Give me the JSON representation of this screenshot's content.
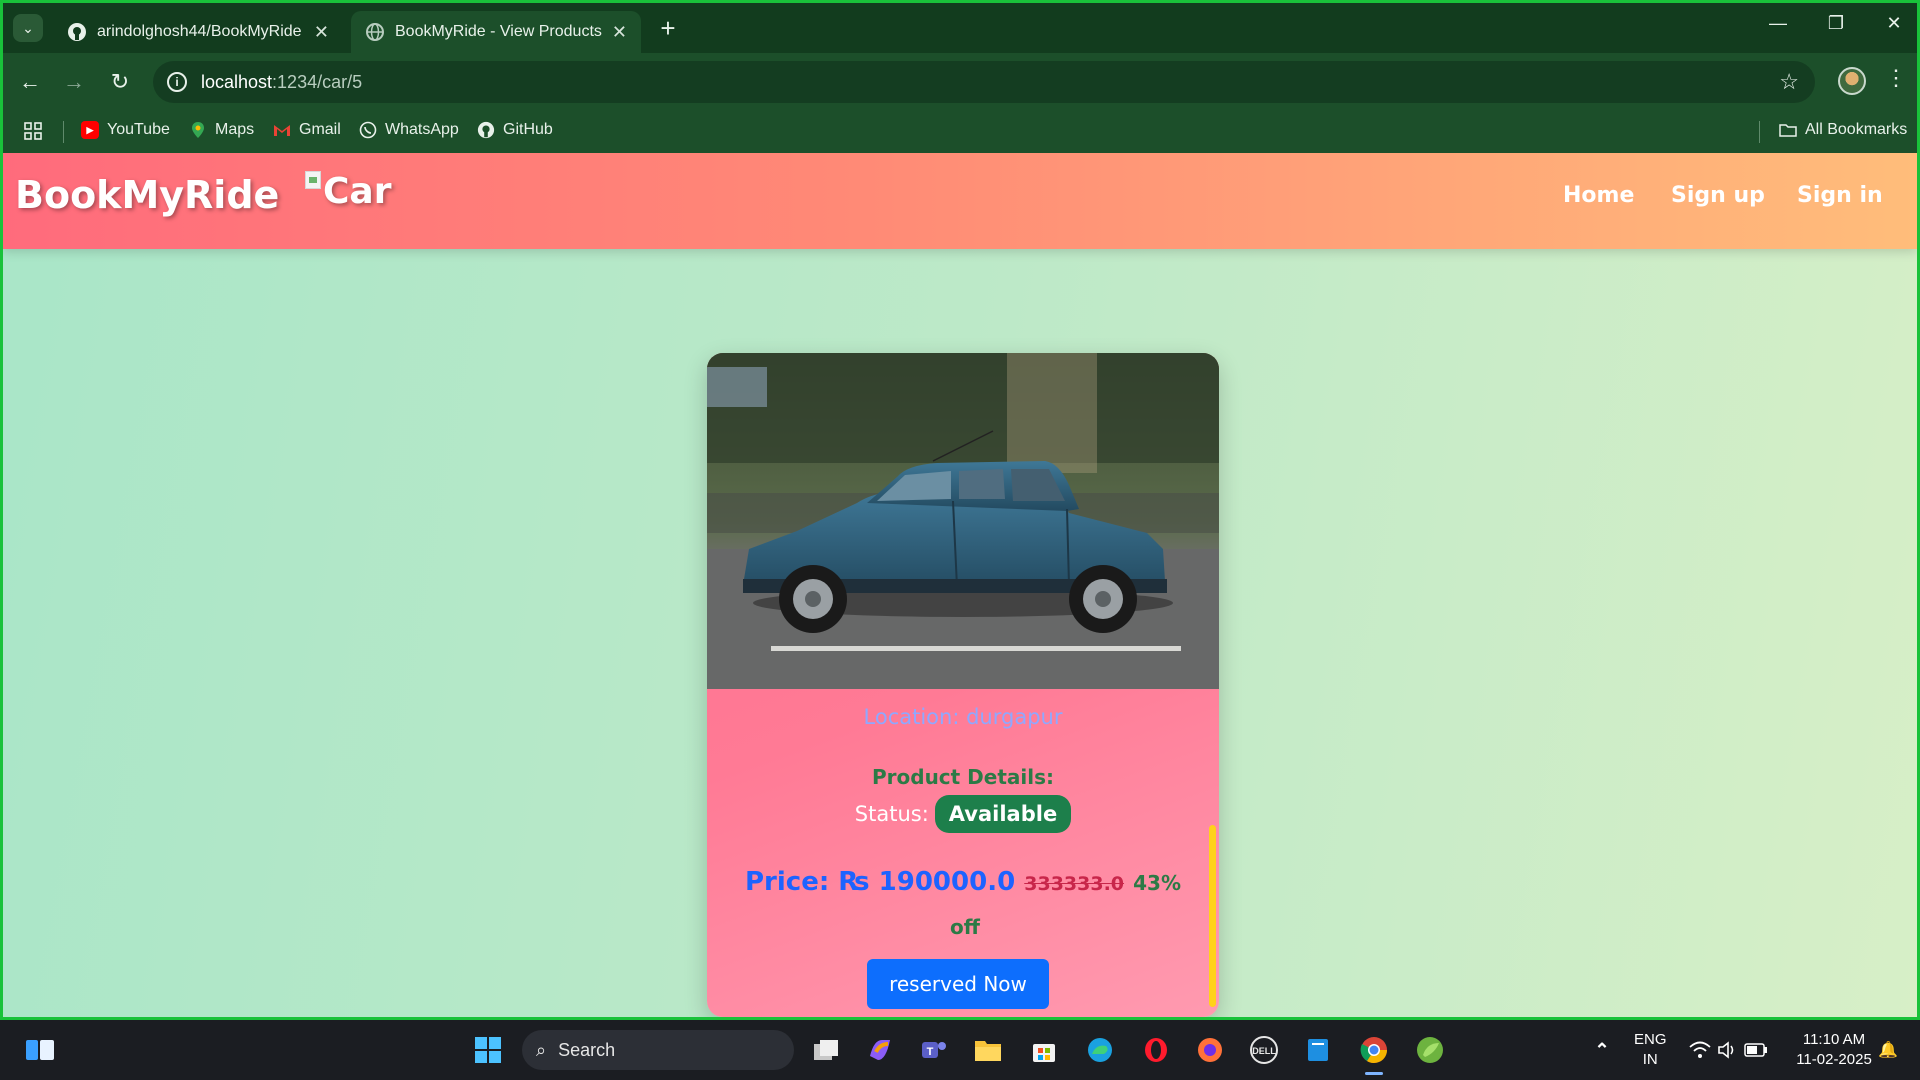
{
  "browser": {
    "tabs": [
      {
        "title": "arindolghosh44/BookMyRide",
        "icon": "github-icon"
      },
      {
        "title": "BookMyRide - View Products",
        "icon": "globe-icon"
      }
    ],
    "url_host": "localhost",
    "url_path": ":1234/car/5",
    "bookmarks": [
      {
        "label": "YouTube",
        "icon": "youtube-icon",
        "color": "#ff0000"
      },
      {
        "label": "Maps",
        "icon": "maps-icon",
        "color": "#34a853"
      },
      {
        "label": "Gmail",
        "icon": "gmail-icon",
        "color": "#ea4335"
      },
      {
        "label": "WhatsApp",
        "icon": "whatsapp-icon",
        "color": "#25d366"
      },
      {
        "label": "GitHub",
        "icon": "github-icon",
        "color": "#ffffff"
      }
    ],
    "all_bookmarks": "All Bookmarks",
    "frame_color": "#19c23a",
    "chrome_color": "#1c4f2a"
  },
  "site": {
    "brand": "BookMyRide",
    "brand_image_alt": "Car",
    "nav": [
      "Home",
      "Sign up",
      "Sign in"
    ]
  },
  "product": {
    "location": "Location: durgapur",
    "details_heading": "Product Details:",
    "status_label": "Status:",
    "status_value": "Available",
    "price_label": "Price: ₨ 190000.0",
    "price_original": "333333.0",
    "discount_a": "43%",
    "discount_b": "off",
    "cta": "reserved Now"
  },
  "taskbar": {
    "search_placeholder": "Search",
    "lang_1": "ENG",
    "lang_2": "IN",
    "time": "11:10 AM",
    "date": "11-02-2025"
  }
}
